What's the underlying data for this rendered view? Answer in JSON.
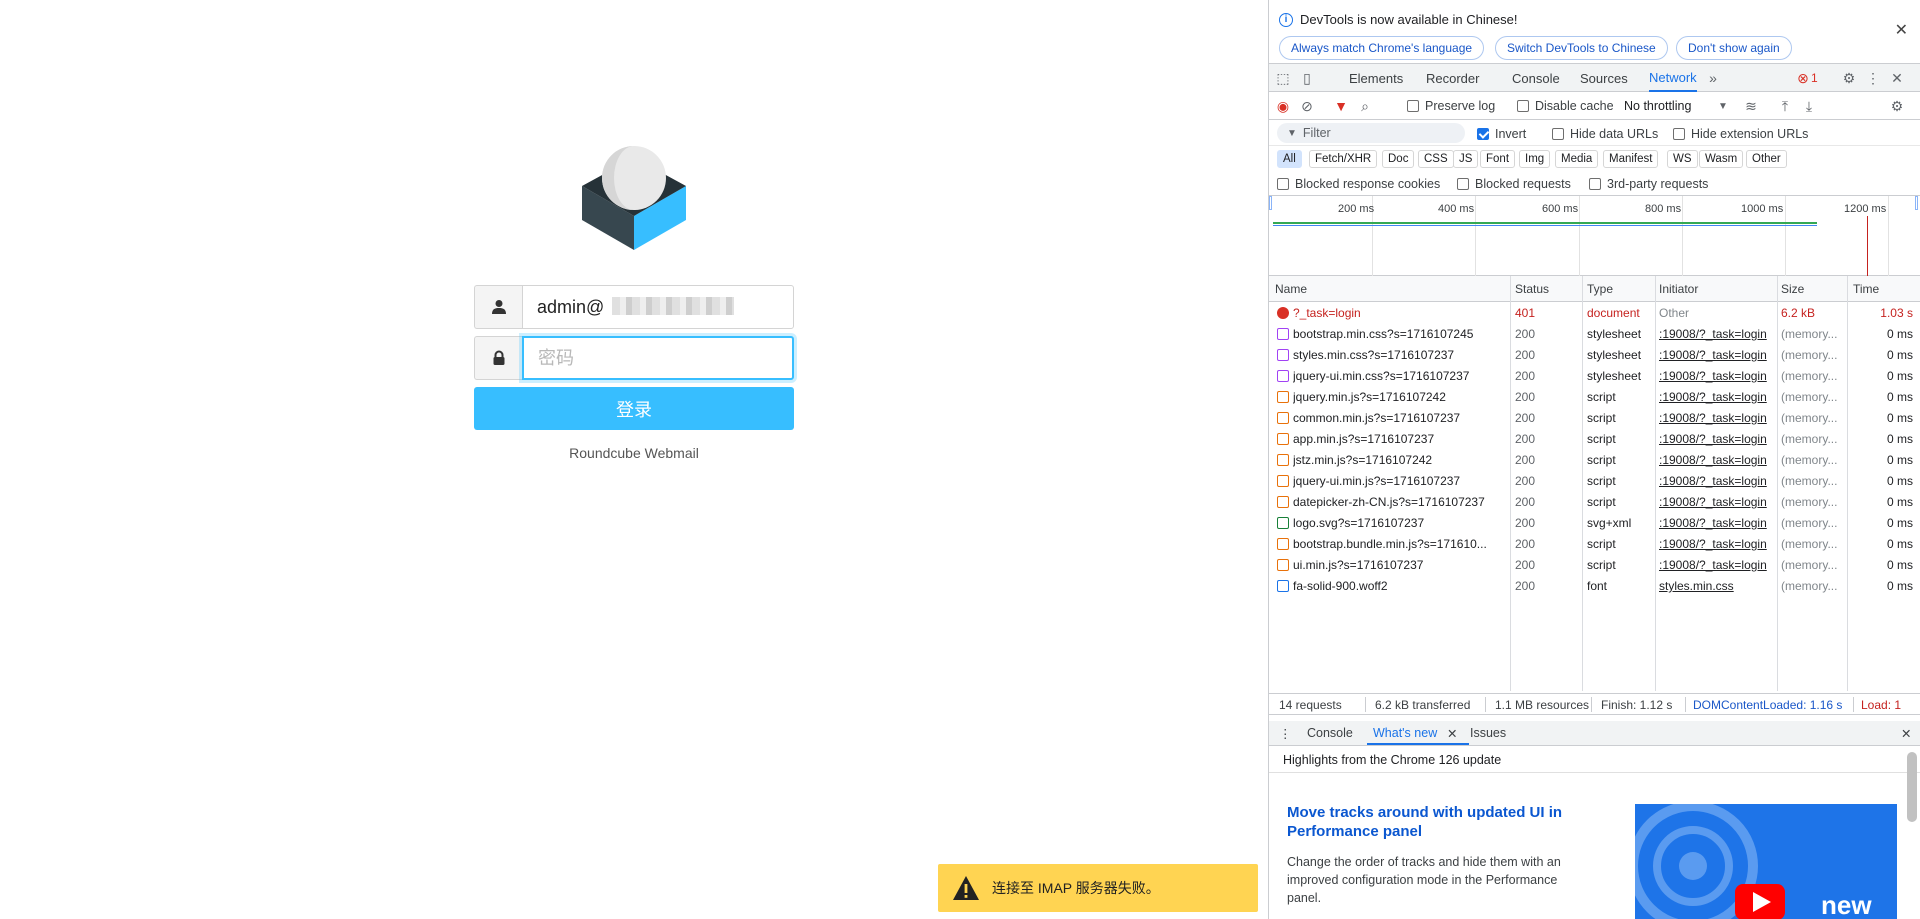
{
  "login": {
    "username_value": "admin@",
    "password_placeholder": "密码",
    "submit_label": "登录",
    "product_name": "Roundcube Webmail"
  },
  "toast": {
    "message": "连接至 IMAP 服务器失败。"
  },
  "devtools": {
    "infobar": {
      "message": "DevTools is now available in Chinese!",
      "btn_match": "Always match Chrome's language",
      "btn_switch": "Switch DevTools to Chinese",
      "btn_dismiss": "Don't show again"
    },
    "tabs": [
      "Elements",
      "Recorder",
      "Console",
      "Sources",
      "Network"
    ],
    "active_tab": "Network",
    "error_count": "1",
    "toolbar": {
      "preserve_log": "Preserve log",
      "disable_cache": "Disable cache",
      "throttling": "No throttling"
    },
    "filter": {
      "placeholder": "Filter",
      "invert": "Invert",
      "hide_data_urls": "Hide data URLs",
      "hide_extension_urls": "Hide extension URLs"
    },
    "types": [
      "All",
      "Fetch/XHR",
      "Doc",
      "CSS",
      "JS",
      "Font",
      "Img",
      "Media",
      "Manifest",
      "WS",
      "Wasm",
      "Other"
    ],
    "active_type": "All",
    "blocked": {
      "cookies": "Blocked response cookies",
      "requests": "Blocked requests",
      "third_party": "3rd-party requests"
    },
    "overview_ticks": [
      "200 ms",
      "400 ms",
      "600 ms",
      "800 ms",
      "1000 ms",
      "1200 ms"
    ],
    "columns": [
      "Name",
      "Status",
      "Type",
      "Initiator",
      "Size",
      "Time"
    ],
    "requests": [
      {
        "name": "?_task=login",
        "status": "401",
        "type": "document",
        "initiator": "Other",
        "size": "6.2 kB",
        "time": "1.03 s",
        "kind": "error"
      },
      {
        "name": "bootstrap.min.css?s=1716107245",
        "status": "200",
        "type": "stylesheet",
        "initiator": ":19008/?_task=login",
        "size": "(memory...",
        "time": "0 ms",
        "kind": "css"
      },
      {
        "name": "styles.min.css?s=1716107237",
        "status": "200",
        "type": "stylesheet",
        "initiator": ":19008/?_task=login",
        "size": "(memory...",
        "time": "0 ms",
        "kind": "css"
      },
      {
        "name": "jquery-ui.min.css?s=1716107237",
        "status": "200",
        "type": "stylesheet",
        "initiator": ":19008/?_task=login",
        "size": "(memory...",
        "time": "0 ms",
        "kind": "css"
      },
      {
        "name": "jquery.min.js?s=1716107242",
        "status": "200",
        "type": "script",
        "initiator": ":19008/?_task=login",
        "size": "(memory...",
        "time": "0 ms",
        "kind": "js"
      },
      {
        "name": "common.min.js?s=1716107237",
        "status": "200",
        "type": "script",
        "initiator": ":19008/?_task=login",
        "size": "(memory...",
        "time": "0 ms",
        "kind": "js"
      },
      {
        "name": "app.min.js?s=1716107237",
        "status": "200",
        "type": "script",
        "initiator": ":19008/?_task=login",
        "size": "(memory...",
        "time": "0 ms",
        "kind": "js"
      },
      {
        "name": "jstz.min.js?s=1716107242",
        "status": "200",
        "type": "script",
        "initiator": ":19008/?_task=login",
        "size": "(memory...",
        "time": "0 ms",
        "kind": "js"
      },
      {
        "name": "jquery-ui.min.js?s=1716107237",
        "status": "200",
        "type": "script",
        "initiator": ":19008/?_task=login",
        "size": "(memory...",
        "time": "0 ms",
        "kind": "js"
      },
      {
        "name": "datepicker-zh-CN.js?s=1716107237",
        "status": "200",
        "type": "script",
        "initiator": ":19008/?_task=login",
        "size": "(memory...",
        "time": "0 ms",
        "kind": "js"
      },
      {
        "name": "logo.svg?s=1716107237",
        "status": "200",
        "type": "svg+xml",
        "initiator": ":19008/?_task=login",
        "size": "(memory...",
        "time": "0 ms",
        "kind": "img"
      },
      {
        "name": "bootstrap.bundle.min.js?s=171610...",
        "status": "200",
        "type": "script",
        "initiator": ":19008/?_task=login",
        "size": "(memory...",
        "time": "0 ms",
        "kind": "js"
      },
      {
        "name": "ui.min.js?s=1716107237",
        "status": "200",
        "type": "script",
        "initiator": ":19008/?_task=login",
        "size": "(memory...",
        "time": "0 ms",
        "kind": "js"
      },
      {
        "name": "fa-solid-900.woff2",
        "status": "200",
        "type": "font",
        "initiator": "styles.min.css",
        "size": "(memory...",
        "time": "0 ms",
        "kind": "font"
      }
    ],
    "summary": {
      "requests": "14 requests",
      "transferred": "6.2 kB transferred",
      "resources": "1.1 MB resources",
      "finish": "Finish: 1.12 s",
      "dcl": "DOMContentLoaded: 1.16 s",
      "load": "Load: 1"
    },
    "drawer": {
      "tabs": [
        "Console",
        "What's new",
        "Issues"
      ],
      "active": "What's new",
      "highlights": "Highlights from the Chrome 126 update",
      "article_title": "Move tracks around with updated UI in Performance panel",
      "article_body": "Change the order of tracks and hide them with an improved configuration mode in the Performance panel.",
      "image_text": "new"
    },
    "colors": {
      "accent": "#1a73e8",
      "error": "#c5221f",
      "roundcube_blue": "#37beff",
      "toast_yellow": "#ffd452"
    }
  }
}
